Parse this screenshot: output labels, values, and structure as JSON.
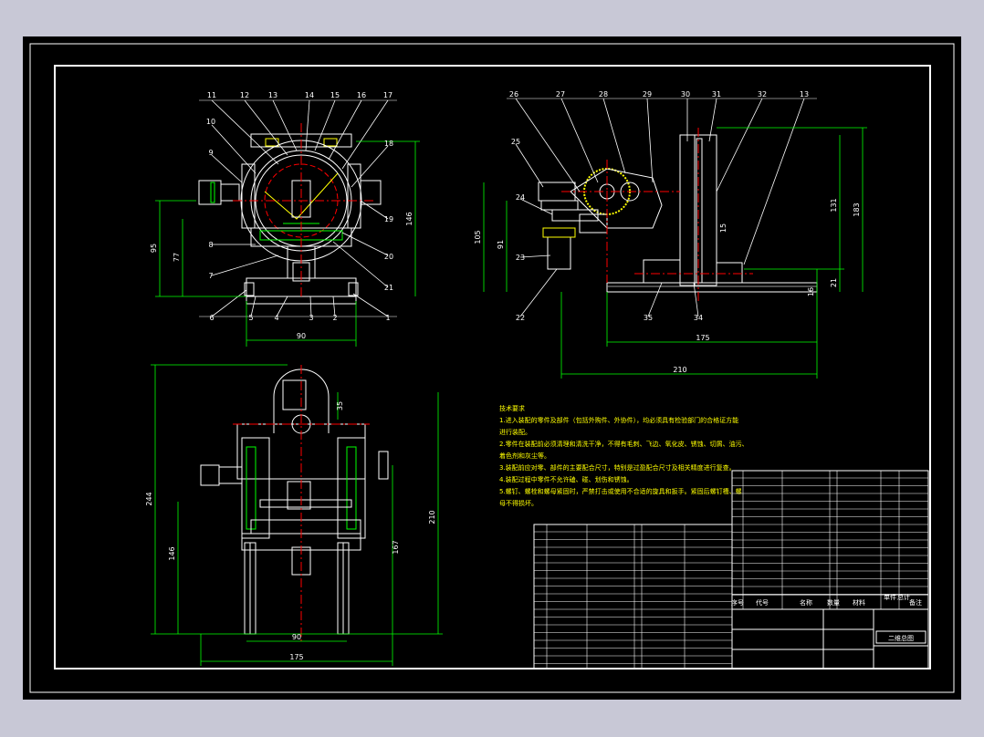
{
  "front_view": {
    "balloons": [
      "11",
      "12",
      "13",
      "14",
      "15",
      "16",
      "17",
      "10",
      "9",
      "18",
      "19",
      "8",
      "20",
      "7",
      "21",
      "6",
      "5",
      "4",
      "3",
      "2",
      "1"
    ],
    "dims": {
      "width": "90",
      "h1": "95",
      "h2": "77",
      "h3": "146"
    }
  },
  "side_view": {
    "balloons": [
      "26",
      "27",
      "28",
      "29",
      "30",
      "31",
      "32",
      "13",
      "25",
      "24",
      "23",
      "22",
      "35",
      "34"
    ],
    "dims": {
      "w1": "175",
      "w2": "210",
      "h1": "105",
      "h2": "91",
      "h3": "131",
      "h4": "183",
      "h5": "16",
      "h6": "21",
      "h7": "15"
    }
  },
  "bottom_view": {
    "dims": {
      "h1": "244",
      "h2": "146",
      "h3": "210",
      "h4": "167",
      "w1": "90",
      "w2": "175",
      "w3": "35"
    }
  },
  "notes": {
    "title": "技术要求",
    "lines": [
      "1.进入装配的零件及部件（包括外购件、外协件），均必须具有检验部门的合格证方能",
      "进行装配。",
      "2.零件在装配前必须清理和清洗干净，不得有毛刺、飞边、氧化皮、锈蚀、切屑、油污、",
      "着色剂和灰尘等。",
      "3.装配前应对零、部件的主要配合尺寸，特别是过盈配合尺寸及相关精度进行复查。",
      "4.装配过程中零件不允许磕、碰、划伤和锈蚀。",
      "5.螺钉、螺栓和螺母紧固时，严禁打击或使用不合适的旋具和扳手。紧固后螺钉槽、螺",
      "母不得损坏。"
    ]
  },
  "title_block": {
    "headers": [
      "序号",
      "代号",
      "名称",
      "数量",
      "材料",
      "单件",
      "总计",
      "备注"
    ],
    "drawing_name": "二维总图"
  }
}
